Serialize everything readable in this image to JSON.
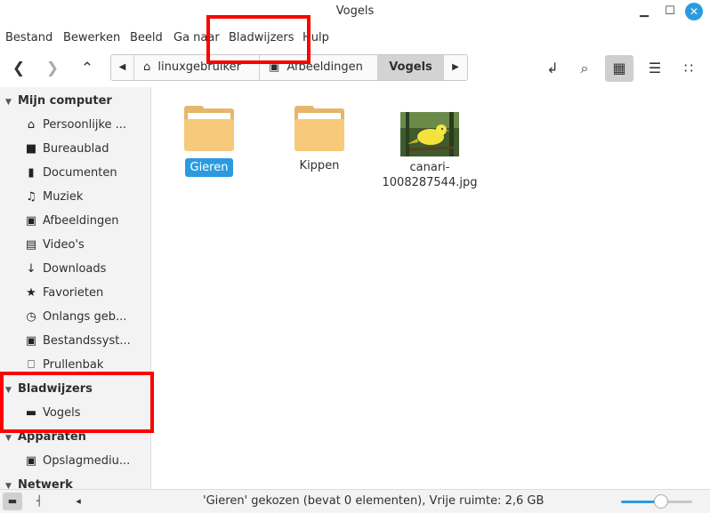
{
  "window": {
    "title": "Vogels"
  },
  "menu": [
    "Bestand",
    "Bewerken",
    "Beeld",
    "Ga naar",
    "Bladwijzers",
    "Hulp"
  ],
  "breadcrumbs": [
    "linuxgebruiker",
    "Afbeeldingen",
    "Vogels"
  ],
  "sidebar": {
    "computer_header": "Mijn computer",
    "computer_items": [
      {
        "label": "Persoonlijke ...",
        "icon": "home-icon"
      },
      {
        "label": "Bureaublad",
        "icon": "desktop-icon"
      },
      {
        "label": "Documenten",
        "icon": "document-icon"
      },
      {
        "label": "Muziek",
        "icon": "music-icon"
      },
      {
        "label": "Afbeeldingen",
        "icon": "camera-icon"
      },
      {
        "label": "Video's",
        "icon": "film-icon"
      },
      {
        "label": "Downloads",
        "icon": "download-icon"
      },
      {
        "label": "Favorieten",
        "icon": "star-icon"
      },
      {
        "label": "Onlangs geb...",
        "icon": "clock-icon"
      },
      {
        "label": "Bestandssyst...",
        "icon": "drive-icon"
      },
      {
        "label": "Prullenbak",
        "icon": "trash-icon"
      }
    ],
    "bookmarks_header": "Bladwijzers",
    "bookmark_items": [
      {
        "label": "Vogels",
        "icon": "folder-icon"
      }
    ],
    "devices_header": "Apparaten",
    "device_items": [
      {
        "label": "Opslagmediu...",
        "icon": "storage-icon"
      }
    ],
    "network_header": "Netwerk"
  },
  "files": [
    {
      "name": "Gieren",
      "type": "folder",
      "selected": true
    },
    {
      "name": "Kippen",
      "type": "folder",
      "selected": false
    },
    {
      "name": "canari-\n1008287544.jpg",
      "type": "image",
      "selected": false
    }
  ],
  "status": {
    "text": "'Gieren' gekozen (bevat 0 elementen), Vrije ruimte: 2,6 GB",
    "zoom_fraction": 0.55
  },
  "colors": {
    "accent": "#2b9be0",
    "highlight": "#ff0000",
    "folder": "#f7c97a"
  }
}
